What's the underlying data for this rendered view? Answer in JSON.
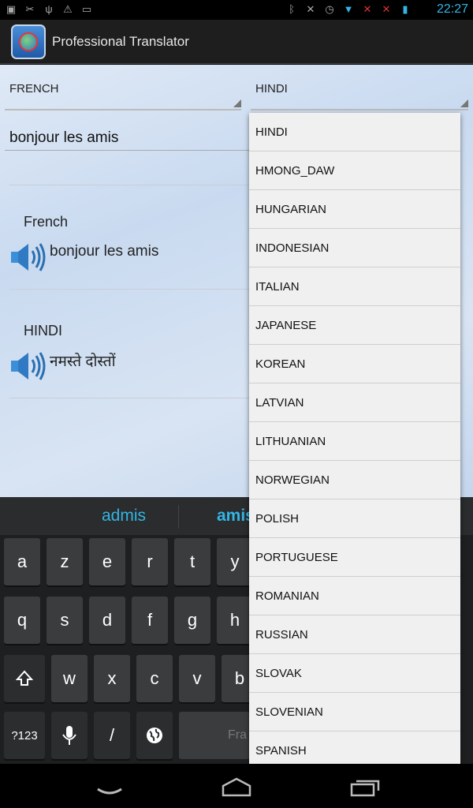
{
  "status_bar": {
    "time": "22:27"
  },
  "app": {
    "title": "Professional Translator"
  },
  "translator": {
    "source_language": "FRENCH",
    "target_language": "HINDI",
    "input_text": "bonjour les amis",
    "source_result": {
      "language_label": "French",
      "text": "bonjour les amis"
    },
    "target_result": {
      "language_label": "HINDI",
      "text": "नमस्ते दोस्तों"
    }
  },
  "keyboard": {
    "suggestions": [
      "admis",
      "amis"
    ],
    "rows": [
      [
        "a",
        "z",
        "e",
        "r",
        "t",
        "y"
      ],
      [
        "q",
        "s",
        "d",
        "f",
        "g",
        "h"
      ],
      [
        "w",
        "x",
        "c",
        "v",
        "b"
      ]
    ],
    "symbols_key": "?123",
    "slash_key": "/",
    "space_hint": "Fra"
  },
  "language_dropdown": {
    "options": [
      "HINDI",
      "HMONG_DAW",
      "HUNGARIAN",
      "INDONESIAN",
      "ITALIAN",
      "JAPANESE",
      "KOREAN",
      "LATVIAN",
      "LITHUANIAN",
      "NORWEGIAN",
      "POLISH",
      "PORTUGUESE",
      "ROMANIAN",
      "RUSSIAN",
      "SLOVAK",
      "SLOVENIAN",
      "SPANISH"
    ]
  },
  "colors": {
    "accent": "#33b5e5",
    "action_bar": "#1e1e1e",
    "keyboard_bg": "#1d1f21"
  }
}
